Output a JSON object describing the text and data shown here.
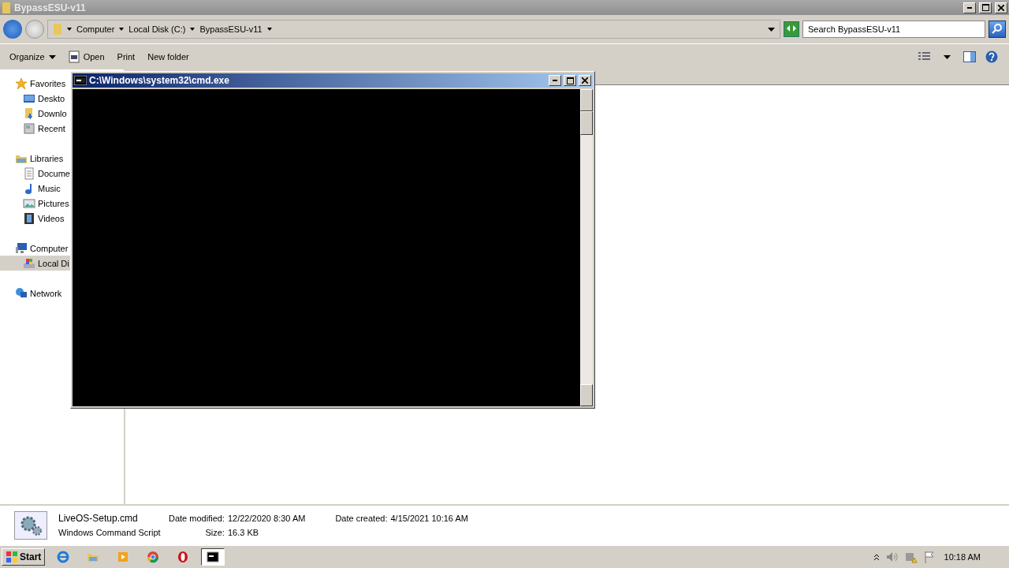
{
  "window": {
    "title": "BypassESU-v11"
  },
  "address": {
    "crumbs": [
      "Computer",
      "Local Disk (C:)",
      "BypassESU-v11"
    ]
  },
  "search": {
    "placeholder": "Search BypassESU-v11"
  },
  "toolbar": {
    "buttons": [
      {
        "label": "Organize",
        "kind": "menu"
      },
      {
        "label": "Open",
        "kind": "icon"
      },
      {
        "label": "Print",
        "kind": "plain"
      },
      {
        "label": "New folder",
        "kind": "plain"
      }
    ]
  },
  "sidebar": {
    "groups": [
      {
        "label": "Favorites",
        "selected": false,
        "children": [
          {
            "label": "Deskto",
            "selected": false
          },
          {
            "label": "Downlo",
            "selected": false
          },
          {
            "label": "Recent",
            "selected": false
          }
        ]
      },
      {
        "label": "Libraries",
        "selected": false,
        "children": [
          {
            "label": "Docume",
            "selected": false
          },
          {
            "label": "Music",
            "selected": false
          },
          {
            "label": "Pictures",
            "selected": false
          },
          {
            "label": "Videos",
            "selected": false
          }
        ]
      },
      {
        "label": "Computer",
        "selected": false,
        "children": [
          {
            "label": "Local Di",
            "selected": true
          }
        ]
      },
      {
        "label": "Network",
        "selected": false
      }
    ]
  },
  "details": {
    "name": "LiveOS-Setup.cmd",
    "type": "Windows Command Script",
    "fields": [
      {
        "label": "Date modified:",
        "value": "12/22/2020 8:30 AM"
      },
      {
        "label": "Size:",
        "value": "16.3 KB"
      },
      {
        "label": "Date created:",
        "value": "4/15/2021 10:16 AM"
      }
    ]
  },
  "console": {
    "title": "C:\\Windows\\system32\\cmd.exe"
  },
  "taskbar": {
    "start": "Start",
    "apps": [
      {
        "selected": false
      },
      {
        "selected": false
      },
      {
        "selected": false
      },
      {
        "selected": false
      },
      {
        "selected": false
      },
      {
        "selected": true
      }
    ],
    "clock": "10:18 AM"
  }
}
